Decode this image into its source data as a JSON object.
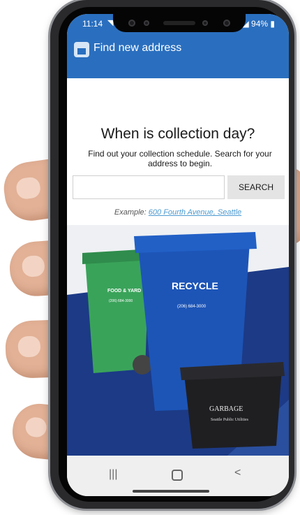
{
  "status_bar": {
    "time": "11:14",
    "wifi_icon": "wifi-icon",
    "battery": "94%"
  },
  "app_bar": {
    "title": "Find new address"
  },
  "main": {
    "heading": "When is collection day?",
    "subtext": "Find out your collection schedule. Search for your address to begin.",
    "search": {
      "value": "",
      "placeholder": ""
    },
    "search_button": "SEARCH",
    "example_prefix": "Example:",
    "example_link": "600 Fourth Avenue, Seattle"
  },
  "hero": {
    "food_bin_label": "FOOD & YARD",
    "food_bin_phone": "(206) 684-3000",
    "recycle_label": "RECYCLE",
    "recycle_phone": "(206) 684-3000",
    "garbage_label": "GARBAGE",
    "garbage_brand": "Seattle Public Utilities",
    "colors": {
      "green": "#3aa35a",
      "blue": "#1d55b7",
      "black": "#1f1f22",
      "backdrop": "#1c3a86"
    }
  },
  "nav_bar": {
    "recent": "|||",
    "back": "<"
  },
  "colors": {
    "primary": "#2a6fbf",
    "link": "#4e9bd1"
  }
}
